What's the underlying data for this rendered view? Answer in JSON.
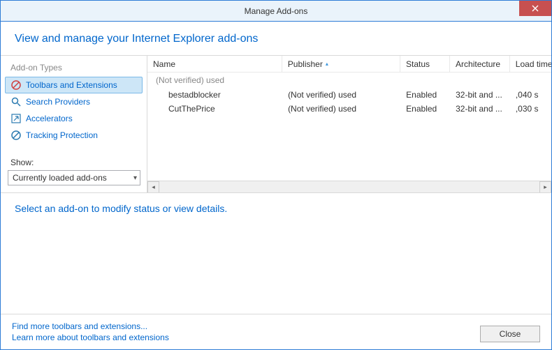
{
  "window": {
    "title": "Manage Add-ons"
  },
  "header": {
    "title": "View and manage your Internet Explorer add-ons"
  },
  "sidebar": {
    "types_label": "Add-on Types",
    "items": [
      {
        "label": "Toolbars and Extensions"
      },
      {
        "label": "Search Providers"
      },
      {
        "label": "Accelerators"
      },
      {
        "label": "Tracking Protection"
      }
    ],
    "show_label": "Show:",
    "show_value": "Currently loaded add-ons"
  },
  "table": {
    "columns": {
      "name": "Name",
      "publisher": "Publisher",
      "status": "Status",
      "architecture": "Architecture",
      "load_time": "Load time"
    },
    "group": "(Not verified) used",
    "rows": [
      {
        "name": "bestadblocker",
        "publisher": "(Not verified) used",
        "status": "Enabled",
        "architecture": "32-bit and ...",
        "load_time": ",040 s"
      },
      {
        "name": "CutThePrice",
        "publisher": "(Not verified) used",
        "status": "Enabled",
        "architecture": "32-bit and ...",
        "load_time": ",030 s"
      }
    ]
  },
  "detail": {
    "prompt": "Select an add-on to modify status or view details."
  },
  "footer": {
    "find_link": "Find more toolbars and extensions...",
    "learn_link": "Learn more about toolbars and extensions",
    "close": "Close"
  }
}
